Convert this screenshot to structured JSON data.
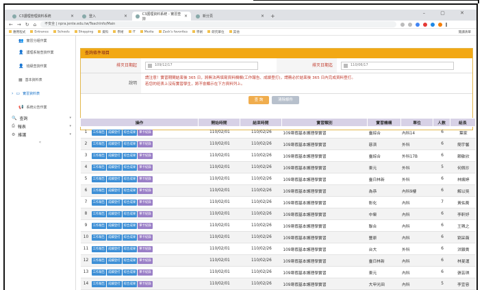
{
  "browser": {
    "tabs": [
      {
        "label": "C3護理管理資料系統",
        "active": false
      },
      {
        "label": "登入",
        "active": false
      },
      {
        "label": "C3護理資料系統 - 實習查詢",
        "active": true
      },
      {
        "label": "新分頁",
        "active": false
      }
    ],
    "url": "不安全 | npra.jente.edu.tw/TeachInfo/Main",
    "bookmarks": [
      "應用程式",
      "Entrance",
      "Schools",
      "Shopping",
      "資料",
      "學術",
      "IT",
      "Media",
      "Zack's favorites",
      "學術",
      "研究單位",
      "其他"
    ],
    "bookmarks_right": "閱讀清單"
  },
  "sidebar": {
    "items": [
      {
        "label": "實習分組作業",
        "icon": "users-icon"
      },
      {
        "label": "護理系館查詢作業",
        "icon": "user-icon"
      },
      {
        "label": "班級查詢作業",
        "icon": "user-plus-icon"
      },
      {
        "label": "基本資料表",
        "icon": "table-icon"
      },
      {
        "label": "實習資料表",
        "icon": "folder-icon",
        "active": true
      },
      {
        "label": "系統公告作業",
        "icon": "megaphone-icon"
      }
    ],
    "sections": [
      {
        "label": "查詢",
        "icon": "search-icon"
      },
      {
        "label": "報表",
        "icon": "print-icon"
      },
      {
        "label": "維護",
        "icon": "gear-icon"
      }
    ],
    "collapse": "«"
  },
  "query": {
    "header": "查詢條件項目",
    "start_label": "排灭日期起",
    "start_value": "109/12/17",
    "end_label": "排灭日期迄",
    "end_value": "110/06/17",
    "note_label": "說明",
    "note_line1": "請注意！實習期間結束後 365 日，將無法再填寫資料欄欄(工作報告、成績登打)，請務必於結束後 365 日內完成資料登打。",
    "note_line2": "若您的班表上沒有實習學生，將不會顯示在下方資料列上。",
    "query_button": "查 詢",
    "clear_button": "清除條件"
  },
  "table": {
    "headers": [
      "操作",
      "開始時間",
      "結束時間",
      "實習類別",
      "實習機構",
      "單位",
      "人數",
      "組長"
    ],
    "op_buttons": [
      "工作報告",
      "成績登打",
      "綜合成果",
      "單卡紀錄"
    ],
    "rows": [
      {
        "n": "1",
        "start": "110/02/01",
        "end": "110/02/26",
        "type": "109寒假基本護理學實習",
        "org": "臺綜合",
        "unit": "內科14",
        "count": "6",
        "leader": "葉家"
      },
      {
        "n": "2",
        "start": "110/02/01",
        "end": "110/02/26",
        "type": "109寒假基本護理學實習",
        "org": "慈濟",
        "unit": "外科",
        "count": "6",
        "leader": "簡宇馨"
      },
      {
        "n": "3",
        "start": "110/02/01",
        "end": "110/02/26",
        "type": "109寒假基本護理學實習",
        "org": "臺綜合",
        "unit": "外科17B",
        "count": "6",
        "leader": "賴敏欣"
      },
      {
        "n": "4",
        "start": "110/02/01",
        "end": "110/02/26",
        "type": "109寒假基本護理學實習",
        "org": "東元",
        "unit": "外科",
        "count": "5",
        "leader": "何佩珍"
      },
      {
        "n": "5",
        "start": "110/02/01",
        "end": "110/02/26",
        "type": "109寒假基本護理學實習",
        "org": "臺日林新",
        "unit": "外科",
        "count": "6",
        "leader": "林姨婷"
      },
      {
        "n": "6",
        "start": "110/02/01",
        "end": "110/02/26",
        "type": "109寒假基本護理學實習",
        "org": "為恭",
        "unit": "內科9樓",
        "count": "6",
        "leader": "解以吳"
      },
      {
        "n": "7",
        "start": "110/02/01",
        "end": "110/02/26",
        "type": "109寒假基本護理學實習",
        "org": "彰化",
        "unit": "內科",
        "count": "7",
        "leader": "黃佑蕎"
      },
      {
        "n": "8",
        "start": "110/02/01",
        "end": "110/02/26",
        "type": "109寒假基本護理學實習",
        "org": "中榮",
        "unit": "內科",
        "count": "6",
        "leader": "李軒妤"
      },
      {
        "n": "9",
        "start": "110/02/01",
        "end": "110/02/26",
        "type": "109寒假基本護理學實習",
        "org": "聯合",
        "unit": "內科",
        "count": "6",
        "leader": "王珮之"
      },
      {
        "n": "10",
        "start": "110/02/01",
        "end": "110/02/26",
        "type": "109寒假基本護理學實習",
        "org": "豐原",
        "unit": "內科",
        "count": "6",
        "leader": "劉采薇"
      },
      {
        "n": "11",
        "start": "110/02/01",
        "end": "110/02/26",
        "type": "109寒假基本護理學實習",
        "org": "台大",
        "unit": "外科",
        "count": "6",
        "leader": "洪穎貴"
      },
      {
        "n": "12",
        "start": "110/02/01",
        "end": "110/02/26",
        "type": "109寒假基本護理學實習",
        "org": "臺日林新",
        "unit": "內科",
        "count": "6",
        "leader": "林旻運"
      },
      {
        "n": "13",
        "start": "110/02/01",
        "end": "110/02/26",
        "type": "109寒假基本護理學實習",
        "org": "東元",
        "unit": "內科",
        "count": "6",
        "leader": "張芸琪"
      },
      {
        "n": "14",
        "start": "110/02/01",
        "end": "110/02/26",
        "type": "109寒假基本護理學實習",
        "org": "大甲光田",
        "unit": "內科",
        "count": "5",
        "leader": "李宜容"
      }
    ]
  }
}
